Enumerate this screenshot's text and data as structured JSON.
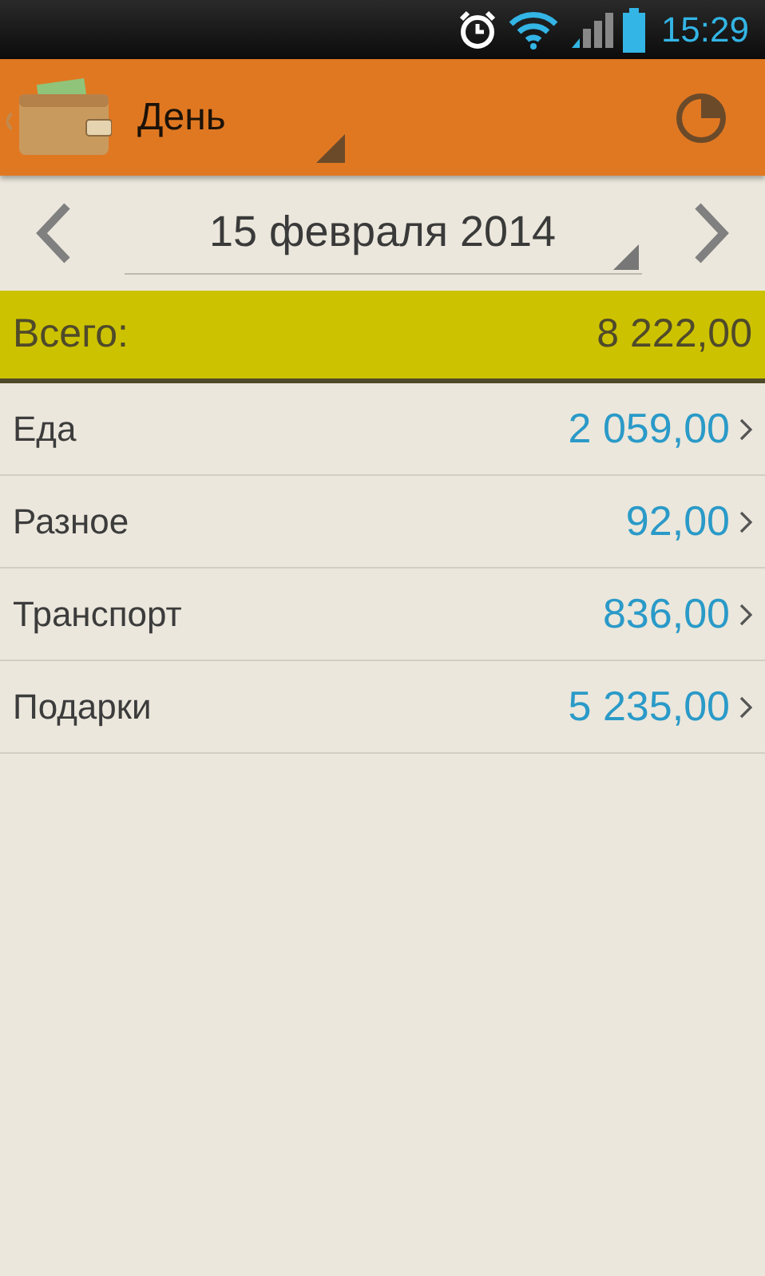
{
  "status_bar": {
    "time": "15:29"
  },
  "action_bar": {
    "period": "День"
  },
  "date_nav": {
    "date": "15 февраля 2014"
  },
  "total": {
    "label": "Всего:",
    "amount": "8 222,00"
  },
  "categories": [
    {
      "name": "Еда",
      "amount": "2 059,00"
    },
    {
      "name": "Разное",
      "amount": "92,00"
    },
    {
      "name": "Транспорт",
      "amount": "836,00"
    },
    {
      "name": "Подарки",
      "amount": "5 235,00"
    }
  ]
}
